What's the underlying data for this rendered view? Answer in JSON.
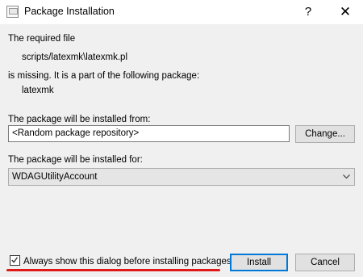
{
  "window": {
    "title": "Package Installation",
    "help_glyph": "?",
    "close_glyph": "✕"
  },
  "message": {
    "required_line": "The required file",
    "file_path": "scripts/latexmk\\latexmk.pl",
    "missing_line": "is missing. It is a part of the following package:",
    "package_name": "latexmk"
  },
  "source": {
    "label": "The package will be installed from:",
    "value": "<Random package repository>",
    "change_button": "Change..."
  },
  "target": {
    "label": "The package will be installed for:",
    "selected": "WDAGUtilityAccount"
  },
  "footer": {
    "always_show_label": "Always show this dialog before installing packages",
    "always_show_checked": true,
    "install_button": "Install",
    "cancel_button": "Cancel"
  },
  "colors": {
    "accent": "#0078d7",
    "highlight_underline": "#e01818"
  },
  "icons": {
    "app": "window-icon",
    "dropdown": "chevron-down-icon",
    "checkbox": "checkmark-icon"
  }
}
